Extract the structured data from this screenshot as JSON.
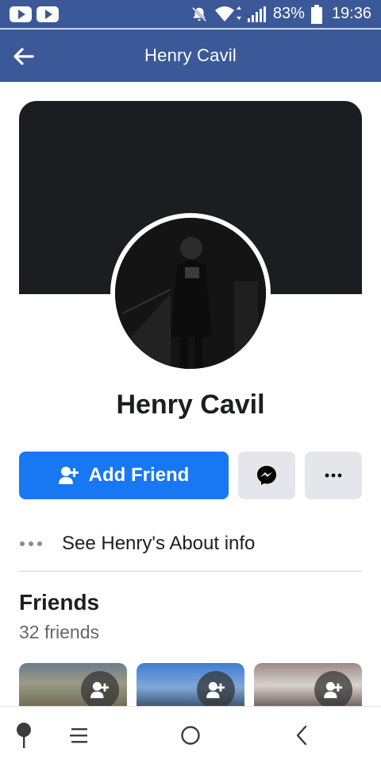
{
  "status_bar": {
    "battery": "83%",
    "time": "19:36"
  },
  "app_bar": {
    "title": "Henry Cavil"
  },
  "profile": {
    "name": "Henry Cavil"
  },
  "actions": {
    "add_friend_label": "Add Friend"
  },
  "about": {
    "label": "See Henry's About info"
  },
  "friends": {
    "title": "Friends",
    "count": "32 friends"
  },
  "colors": {
    "brand": "#3b5998",
    "primary_button": "#1877f2",
    "secondary_button": "#e4e6eb"
  },
  "icons": {
    "back": "arrow-left-icon",
    "add_friend": "person-plus-icon",
    "messenger": "messenger-icon",
    "more": "more-dots-icon",
    "about": "ellipsis-icon"
  }
}
